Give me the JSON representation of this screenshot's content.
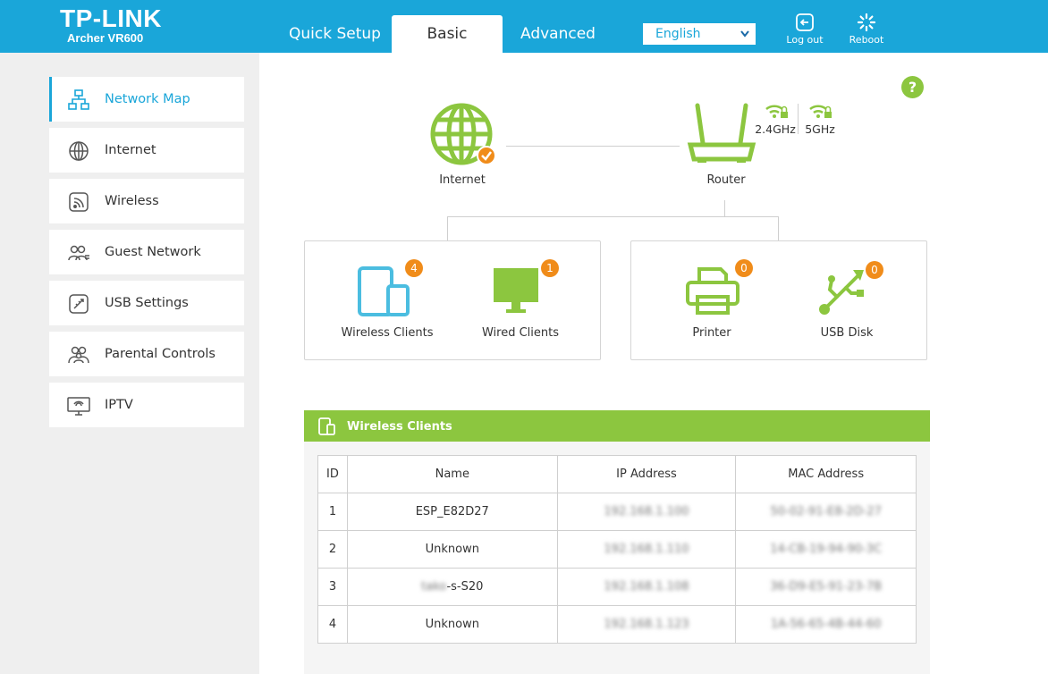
{
  "header": {
    "brand": "TP-LINK",
    "model": "Archer VR600",
    "tabs": [
      {
        "label": "Quick Setup"
      },
      {
        "label": "Basic"
      },
      {
        "label": "Advanced"
      }
    ],
    "language": "English",
    "logout_label": "Log out",
    "reboot_label": "Reboot"
  },
  "sidebar": {
    "items": [
      {
        "label": "Network Map",
        "icon": "network-map-icon"
      },
      {
        "label": "Internet",
        "icon": "globe-icon"
      },
      {
        "label": "Wireless",
        "icon": "wireless-icon"
      },
      {
        "label": "Guest Network",
        "icon": "guest-network-icon"
      },
      {
        "label": "USB Settings",
        "icon": "usb-settings-icon"
      },
      {
        "label": "Parental Controls",
        "icon": "parental-controls-icon"
      },
      {
        "label": "IPTV",
        "icon": "iptv-icon"
      }
    ]
  },
  "map": {
    "help": "?",
    "internet_label": "Internet",
    "router_label": "Router",
    "band_24": "2.4GHz",
    "band_5": "5GHz",
    "wireless_clients": {
      "label": "Wireless Clients",
      "count": "4"
    },
    "wired_clients": {
      "label": "Wired Clients",
      "count": "1"
    },
    "printer": {
      "label": "Printer",
      "count": "0"
    },
    "usb_disk": {
      "label": "USB Disk",
      "count": "0"
    }
  },
  "clients_panel": {
    "title": "Wireless Clients",
    "columns": [
      "ID",
      "Name",
      "IP Address",
      "MAC Address"
    ],
    "rows": [
      {
        "id": "1",
        "name": "ESP_E82D27",
        "ip": "192.168.1.100",
        "mac": "50-02-91-E8-2D-27"
      },
      {
        "id": "2",
        "name": "Unknown",
        "ip": "192.168.1.110",
        "mac": "14-CB-19-94-90-3C"
      },
      {
        "id": "3",
        "name_blur": "tako",
        "name": "-s-S20",
        "ip": "192.168.1.108",
        "mac": "36-D9-E5-91-23-7B"
      },
      {
        "id": "4",
        "name": "Unknown",
        "ip": "192.168.1.123",
        "mac": "1A-56-65-4B-44-60"
      }
    ]
  },
  "colors": {
    "header_blue": "#1aa6d9",
    "green": "#8cc63f",
    "badge_orange": "#f08c1a"
  }
}
